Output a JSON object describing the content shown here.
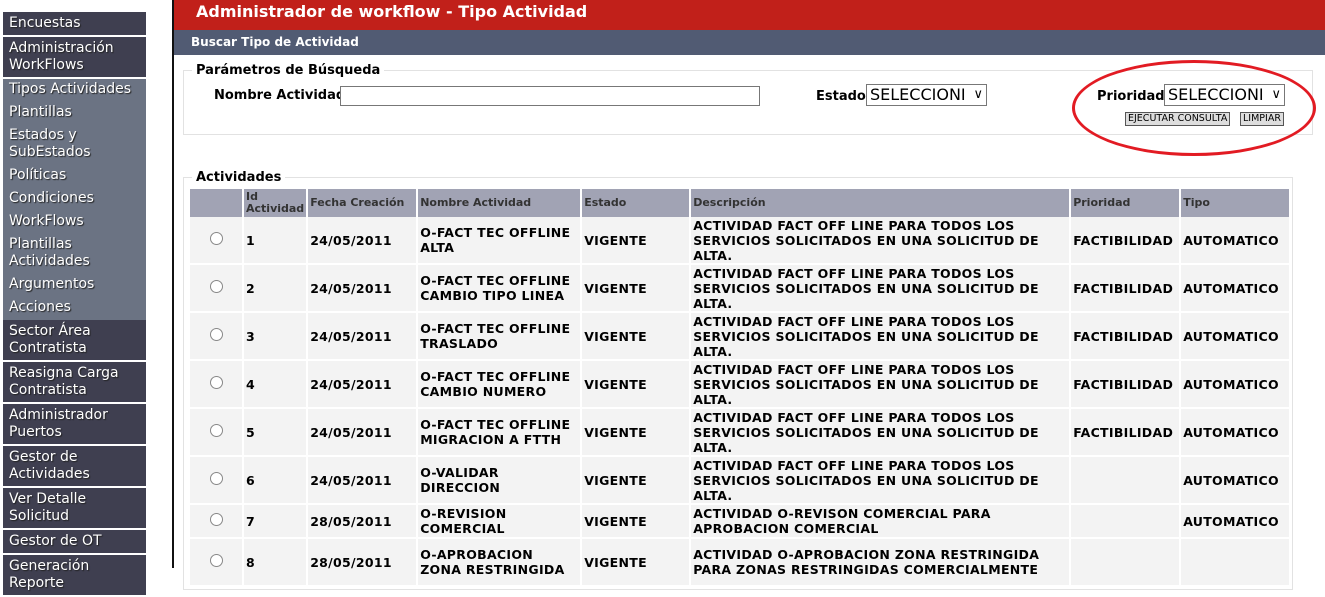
{
  "sidebar": [
    {
      "label": "Encuestas",
      "style": "dark"
    },
    {
      "label": "Administración WorkFlows",
      "style": "dark"
    },
    {
      "label": "Tipos Actividades",
      "style": "sub"
    },
    {
      "label": "Plantillas",
      "style": "sub"
    },
    {
      "label": "Estados y SubEstados",
      "style": "sub"
    },
    {
      "label": "Políticas",
      "style": "sub"
    },
    {
      "label": "Condiciones",
      "style": "sub"
    },
    {
      "label": "WorkFlows",
      "style": "sub"
    },
    {
      "label": "Plantillas Actividades",
      "style": "sub"
    },
    {
      "label": "Argumentos",
      "style": "sub"
    },
    {
      "label": "Acciones",
      "style": "sub"
    },
    {
      "label": "Sector Área Contratista",
      "style": "dark"
    },
    {
      "label": "Reasigna Carga Contratista",
      "style": "dark"
    },
    {
      "label": "Administrador Puertos",
      "style": "dark"
    },
    {
      "label": "Gestor de Actividades",
      "style": "dark"
    },
    {
      "label": "Ver Detalle Solicitud",
      "style": "dark"
    },
    {
      "label": "Gestor de OT",
      "style": "dark"
    },
    {
      "label": "Generación Reporte",
      "style": "dark"
    }
  ],
  "header": {
    "title": "Administrador de workflow - Tipo Actividad",
    "subtitle": "Buscar Tipo de Actividad"
  },
  "search": {
    "legend": "Parámetros de Búsqueda",
    "nombre_label": "Nombre Actividad",
    "nombre_value": "",
    "estado_label": "Estado",
    "estado_value": "SELECCIONI",
    "prioridad_label": "Prioridad",
    "prioridad_value": "SELECCIONI",
    "execute_label": "EJECUTAR CONSULTA",
    "clear_label": "LIMPIAR"
  },
  "table": {
    "legend": "Actividades",
    "headers": [
      "",
      "Id Actividad",
      "Fecha Creación",
      "Nombre Actividad",
      "Estado",
      "Descripción",
      "Prioridad",
      "Tipo"
    ],
    "rows": [
      [
        "1",
        "24/05/2011",
        "O-FACT TEC OFFLINE ALTA",
        "VIGENTE",
        "ACTIVIDAD FACT OFF LINE PARA TODOS LOS SERVICIOS SOLICITADOS EN UNA SOLICITUD DE ALTA.",
        "FACTIBILIDAD",
        "AUTOMATICO"
      ],
      [
        "2",
        "24/05/2011",
        "O-FACT TEC OFFLINE CAMBIO TIPO LINEA",
        "VIGENTE",
        "ACTIVIDAD FACT OFF LINE PARA TODOS LOS SERVICIOS SOLICITADOS EN UNA SOLICITUD DE ALTA.",
        "FACTIBILIDAD",
        "AUTOMATICO"
      ],
      [
        "3",
        "24/05/2011",
        "O-FACT TEC OFFLINE TRASLADO",
        "VIGENTE",
        "ACTIVIDAD FACT OFF LINE PARA TODOS LOS SERVICIOS SOLICITADOS EN UNA SOLICITUD DE ALTA.",
        "FACTIBILIDAD",
        "AUTOMATICO"
      ],
      [
        "4",
        "24/05/2011",
        "O-FACT TEC OFFLINE CAMBIO NUMERO",
        "VIGENTE",
        "ACTIVIDAD FACT OFF LINE PARA TODOS LOS SERVICIOS SOLICITADOS EN UNA SOLICITUD DE ALTA.",
        "FACTIBILIDAD",
        "AUTOMATICO"
      ],
      [
        "5",
        "24/05/2011",
        "O-FACT TEC OFFLINE MIGRACION A FTTH",
        "VIGENTE",
        "ACTIVIDAD FACT OFF LINE PARA TODOS LOS SERVICIOS SOLICITADOS EN UNA SOLICITUD DE ALTA.",
        "FACTIBILIDAD",
        "AUTOMATICO"
      ],
      [
        "6",
        "24/05/2011",
        "O-VALIDAR DIRECCION",
        "VIGENTE",
        "ACTIVIDAD FACT OFF LINE PARA TODOS LOS SERVICIOS SOLICITADOS EN UNA SOLICITUD DE ALTA.",
        "",
        "AUTOMATICO"
      ],
      [
        "7",
        "28/05/2011",
        "O-REVISION COMERCIAL",
        "VIGENTE",
        "ACTIVIDAD O-REVISON COMERCIAL PARA APROBACION COMERCIAL",
        "",
        "AUTOMATICO"
      ],
      [
        "8",
        "28/05/2011",
        "O-APROBACION ZONA RESTRINGIDA",
        "VIGENTE",
        "ACTIVIDAD O-APROBACION ZONA RESTRINGIDA PARA ZONAS RESTRINGIDAS COMERCIALMENTE",
        "",
        ""
      ]
    ]
  },
  "colors": {
    "header": "#c1201a",
    "subheader": "#515b73",
    "sidebar_dark": "#3f3f50",
    "sidebar_sub": "#6b7383",
    "highlight": "#e21b23"
  }
}
